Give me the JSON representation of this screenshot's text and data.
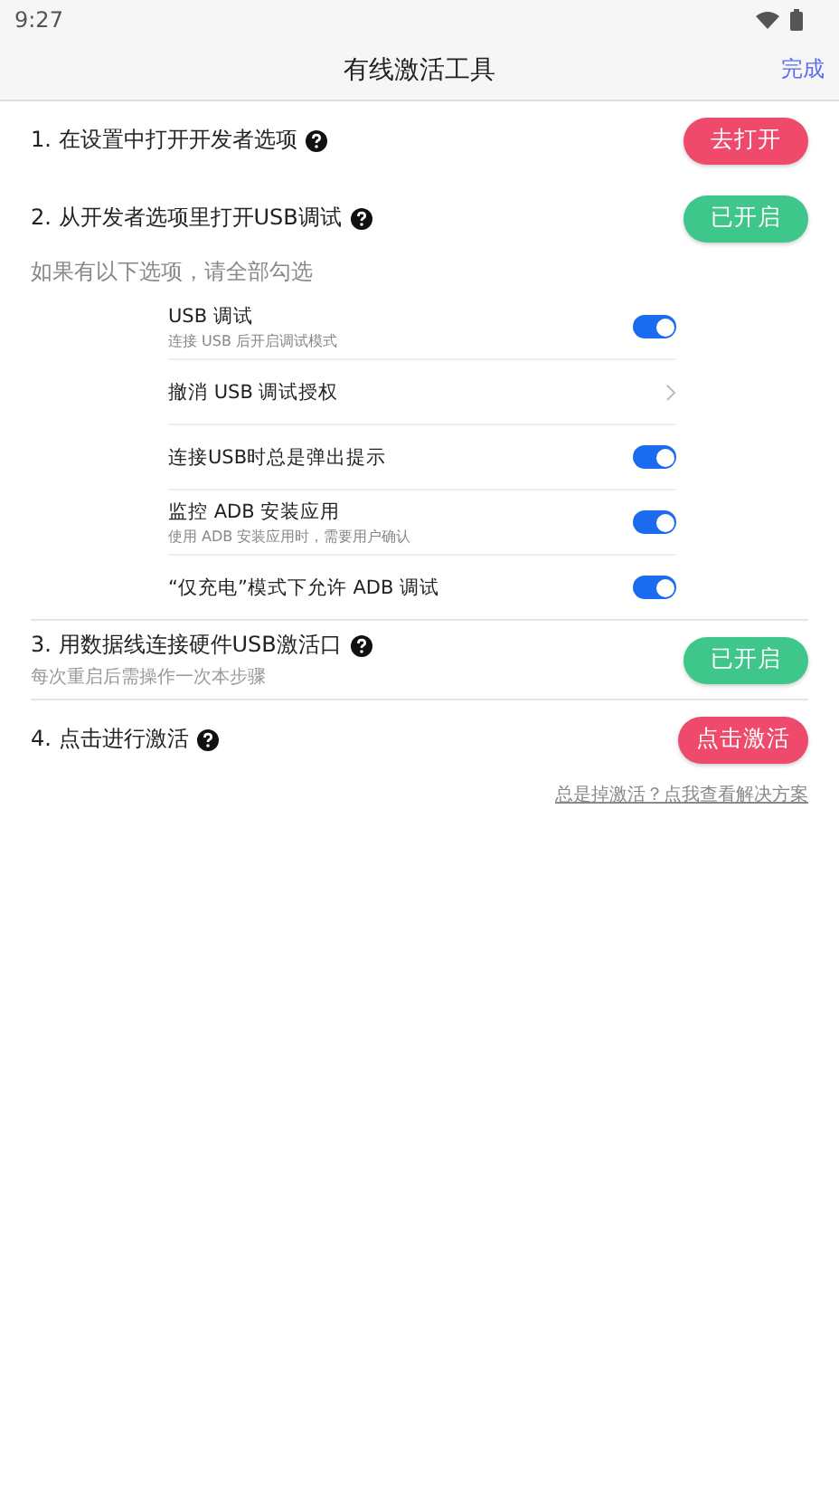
{
  "status_bar": {
    "time": "9:27"
  },
  "header": {
    "title": "有线激活工具",
    "action": "完成"
  },
  "steps": [
    {
      "label": "1. 在设置中打开开发者选项",
      "button": "去打开",
      "done": false
    },
    {
      "label": "2. 从开发者选项里打开USB调试",
      "button": "已开启",
      "done": true,
      "hint": "如果有以下选项，请全部勾选",
      "options": [
        {
          "kind": "toggle",
          "title": "USB 调试",
          "subtitle": "连接 USB 后开启调试模式",
          "on": true
        },
        {
          "kind": "link",
          "title": "撤消 USB 调试授权"
        },
        {
          "kind": "toggle",
          "title": "连接USB时总是弹出提示",
          "on": true
        },
        {
          "kind": "toggle",
          "title": "监控 ADB 安装应用",
          "subtitle": "使用 ADB 安装应用时，需要用户确认",
          "on": true
        },
        {
          "kind": "toggle",
          "title": "“仅充电”模式下允许 ADB 调试",
          "on": true
        }
      ]
    },
    {
      "label": "3. 用数据线连接硬件USB激活口",
      "subtitle": "每次重启后需操作一次本步骤",
      "button": "已开启",
      "done": true
    },
    {
      "label": "4. 点击进行激活",
      "button": "点击激活",
      "done": false
    }
  ],
  "help_link": "总是掉激活？点我查看解决方案"
}
